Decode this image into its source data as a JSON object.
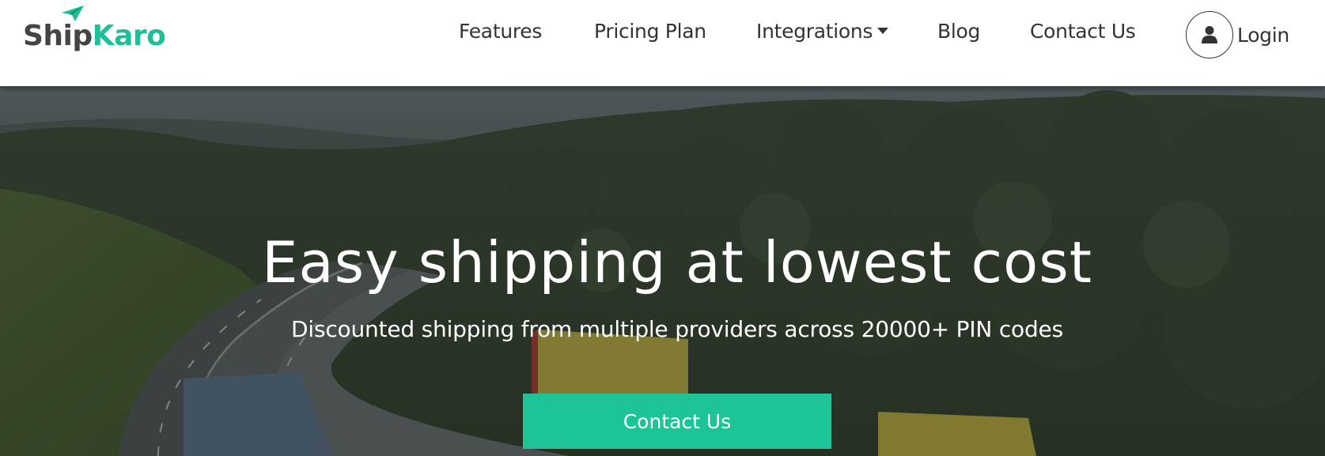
{
  "brand": {
    "name_part_a": "Ship",
    "name_part_b": "Karo",
    "primary_color": "#1cbf98",
    "text_color": "#444444",
    "logo_icon": "paper-plane-icon"
  },
  "nav": {
    "features": "Features",
    "pricing": "Pricing Plan",
    "integrations": "Integrations",
    "integrations_icon": "caret-down-icon",
    "blog": "Blog",
    "contact": "Contact Us",
    "login": "Login",
    "login_icon": "user-icon"
  },
  "hero": {
    "title": "Easy shipping at lowest cost",
    "subtitle": "Discounted shipping from multiple providers across 20000+ PIN codes",
    "cta_label": "Contact Us",
    "cta_color": "#1cc497",
    "background": "highway-through-forest-with-trucks"
  }
}
